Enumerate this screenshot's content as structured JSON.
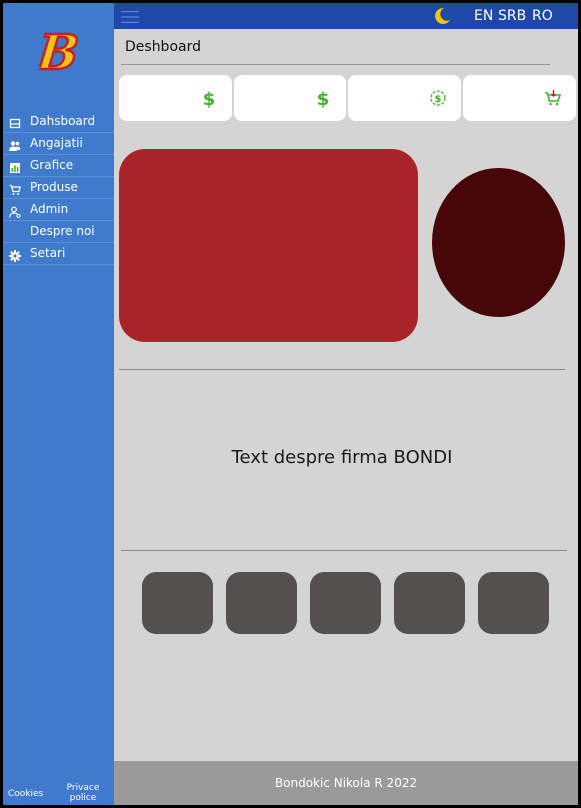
{
  "sidebar": {
    "logo_letter": "B",
    "items": [
      {
        "label": "Dahsboard",
        "icon": "dashboard-icon"
      },
      {
        "label": "Angajatii",
        "icon": "users-icon"
      },
      {
        "label": "Grafice",
        "icon": "chart-icon"
      },
      {
        "label": "Produse",
        "icon": "cart-icon"
      },
      {
        "label": "Admin",
        "icon": "admin-user-icon"
      },
      {
        "label": "Despre noi",
        "icon": ""
      },
      {
        "label": "Setari",
        "icon": "gear-icon"
      }
    ],
    "footer": {
      "cookies": "Cookies",
      "privacy": "Privace police"
    }
  },
  "topbar": {
    "menu_icon": "hamburger-icon",
    "theme_icon": "moon-icon",
    "languages": [
      "EN",
      "SRB",
      "RO"
    ]
  },
  "main": {
    "page_title": "Deshboard",
    "cards": [
      {
        "icon": "dollar-icon"
      },
      {
        "icon": "dollar-icon"
      },
      {
        "icon": "dollar-cycle-icon"
      },
      {
        "icon": "shopping-cart-icon"
      }
    ],
    "about_text": "Text despre firma BONDI",
    "footer_text": "Bondokic Nikola R 2022"
  },
  "colors": {
    "sidebar_bg": "#3f7acd",
    "topbar_bg": "#1f49a8",
    "content_bg": "#d4d4d4",
    "panel_red": "#a82428",
    "ellipse_dark": "#470607",
    "button_gray": "#545050",
    "footer_gray": "#9a9a9a",
    "icon_green": "#3cb526",
    "moon_yellow": "#f4c40b"
  }
}
